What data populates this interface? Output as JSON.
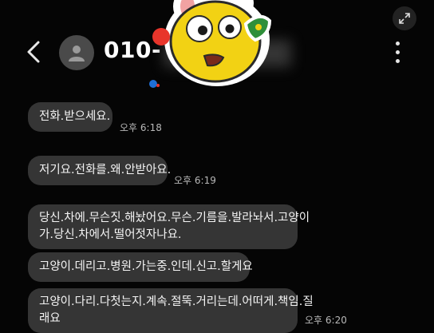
{
  "header": {
    "back_icon": "chevron-left-icon",
    "avatar_icon": "person-icon",
    "phone_number_visible": "010-",
    "menu_icon": "more-vertical-icon",
    "expand_icon": "expand-icon",
    "sticker": "yellow-cartoon-face-sticker"
  },
  "messages": [
    {
      "text": "전화.받으세요.",
      "time": "오후 6:18"
    },
    {
      "text": "저기요.전화를.왜.안받아요.",
      "time": "오후 6:19"
    },
    {
      "lines": [
        "당신.차에.무슨짓.해놨어요.무슨.기름을.발라놔서.고양이",
        "가.당신.차에서.떨어젓자나요."
      ]
    },
    {
      "text": "고양이.데리고.병원.가는중.인데.신고.할게요"
    },
    {
      "lines": [
        "고양이.다리.다첫는지.계속.절뚝.거리는데.어떠게.책임.질",
        "래요"
      ],
      "time": "오후 6:20"
    }
  ],
  "colors": {
    "background": "#050505",
    "bubble": "#353535",
    "text": "#f4f4f4",
    "time": "#b8b8b8"
  }
}
